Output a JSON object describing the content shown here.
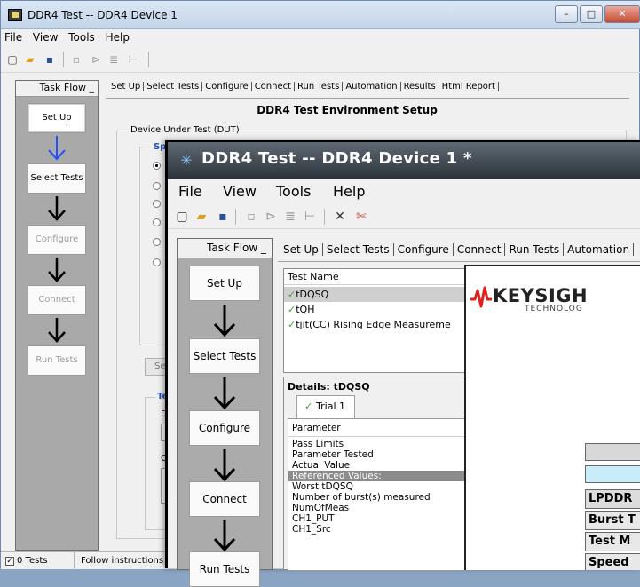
{
  "back_window": {
    "title": "DDR4 Test -- DDR4 Device 1",
    "controls": {
      "minimize": "–",
      "maximize": "□",
      "close": "✕"
    },
    "menu": [
      "File",
      "View",
      "Tools",
      "Help"
    ],
    "task_flow": {
      "header": "Task Flow _",
      "steps": [
        "Set Up",
        "Select Tests",
        "Configure",
        "Connect",
        "Run Tests"
      ]
    },
    "tabs": [
      "Set Up",
      "Select Tests",
      "Configure",
      "Connect",
      "Run Tests",
      "Automation",
      "Results",
      "Html Report"
    ],
    "heading": "DDR4 Test Environment Setup",
    "dut_group_label": "Device Under Test (DUT)",
    "sp_label": "Sp",
    "set_button_label": "Se",
    "te_label": "Te",
    "d_label": "D",
    "c_label": "C",
    "status": {
      "tests_count": "0 Tests",
      "message": "Follow instructions t"
    }
  },
  "front_window": {
    "title": "DDR4 Test -- DDR4 Device 1 *",
    "menu": [
      "File",
      "View",
      "Tools",
      "Help"
    ],
    "task_flow": {
      "header": "Task Flow _",
      "steps": [
        "Set Up",
        "Select Tests",
        "Configure",
        "Connect",
        "Run Tests"
      ]
    },
    "tabs": [
      "Set Up",
      "Select Tests",
      "Configure",
      "Connect",
      "Run Tests",
      "Automation"
    ],
    "test_list": {
      "header": "Test Name",
      "items": [
        "tDQSQ",
        "tQH",
        "tjit(CC) Rising Edge Measureme"
      ]
    },
    "details": {
      "title": "Details: tDQSQ",
      "trial_tab": "Trial 1",
      "param_header": "Parameter",
      "params": [
        "Pass Limits",
        "Parameter Tested",
        "Actual Value",
        "Referenced Values:",
        "Worst tDQSQ",
        "Number of burst(s) measured",
        "NumOfMeas",
        "CH1_PUT",
        "CH1_Src"
      ]
    },
    "report": {
      "logo_text": "KEYSIGH",
      "logo_sub": "TECHNOLOG",
      "table_rows": [
        "LPDDR",
        "Burst T",
        "Test M",
        "Speed"
      ]
    }
  },
  "colors": {
    "accent_check": "#3aa53a",
    "keysight_red": "#e0201b",
    "blue_arrow": "#1f4fff"
  }
}
